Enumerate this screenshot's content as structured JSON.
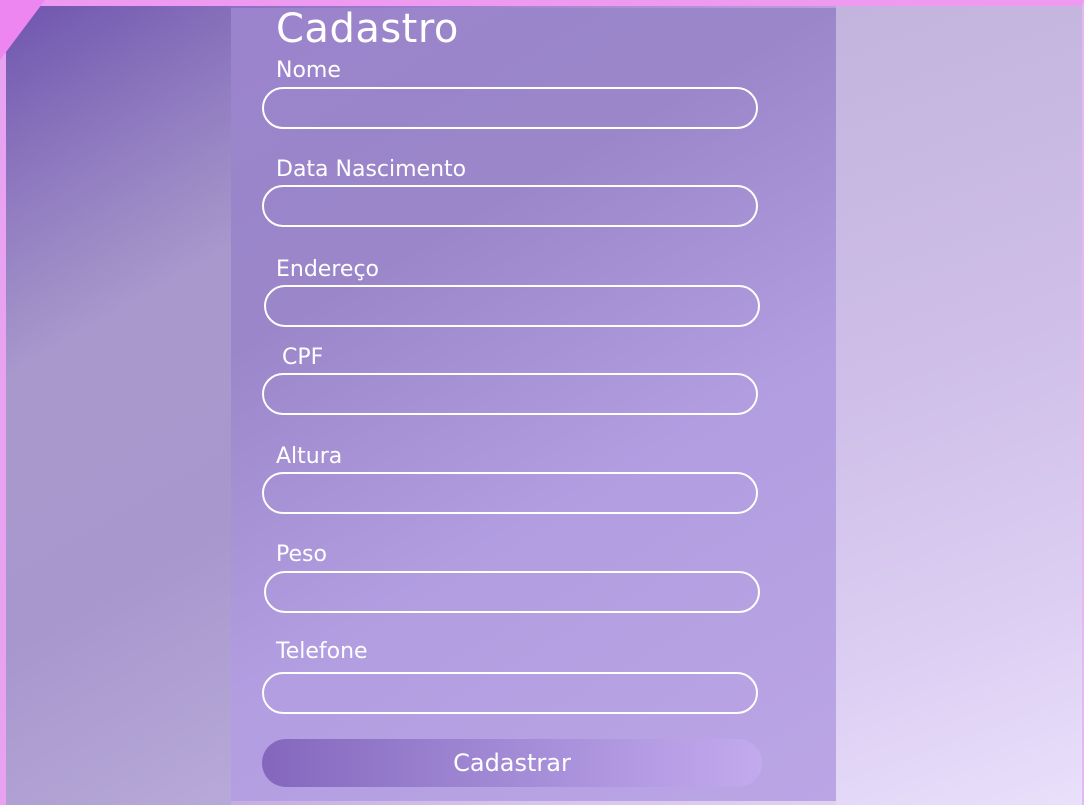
{
  "form": {
    "title": "Cadastro",
    "fields": [
      {
        "label": "Nome",
        "value": ""
      },
      {
        "label": "Data Nascimento",
        "value": ""
      },
      {
        "label": "Endereço",
        "value": ""
      },
      {
        "label": "CPF",
        "value": ""
      },
      {
        "label": "Altura",
        "value": ""
      },
      {
        "label": "Peso",
        "value": ""
      },
      {
        "label": "Telefone",
        "value": ""
      }
    ],
    "submit_label": "Cadastrar"
  },
  "colors": {
    "accent": "#9b84cd",
    "text": "#ffffff",
    "frame": "#ee9af0"
  }
}
